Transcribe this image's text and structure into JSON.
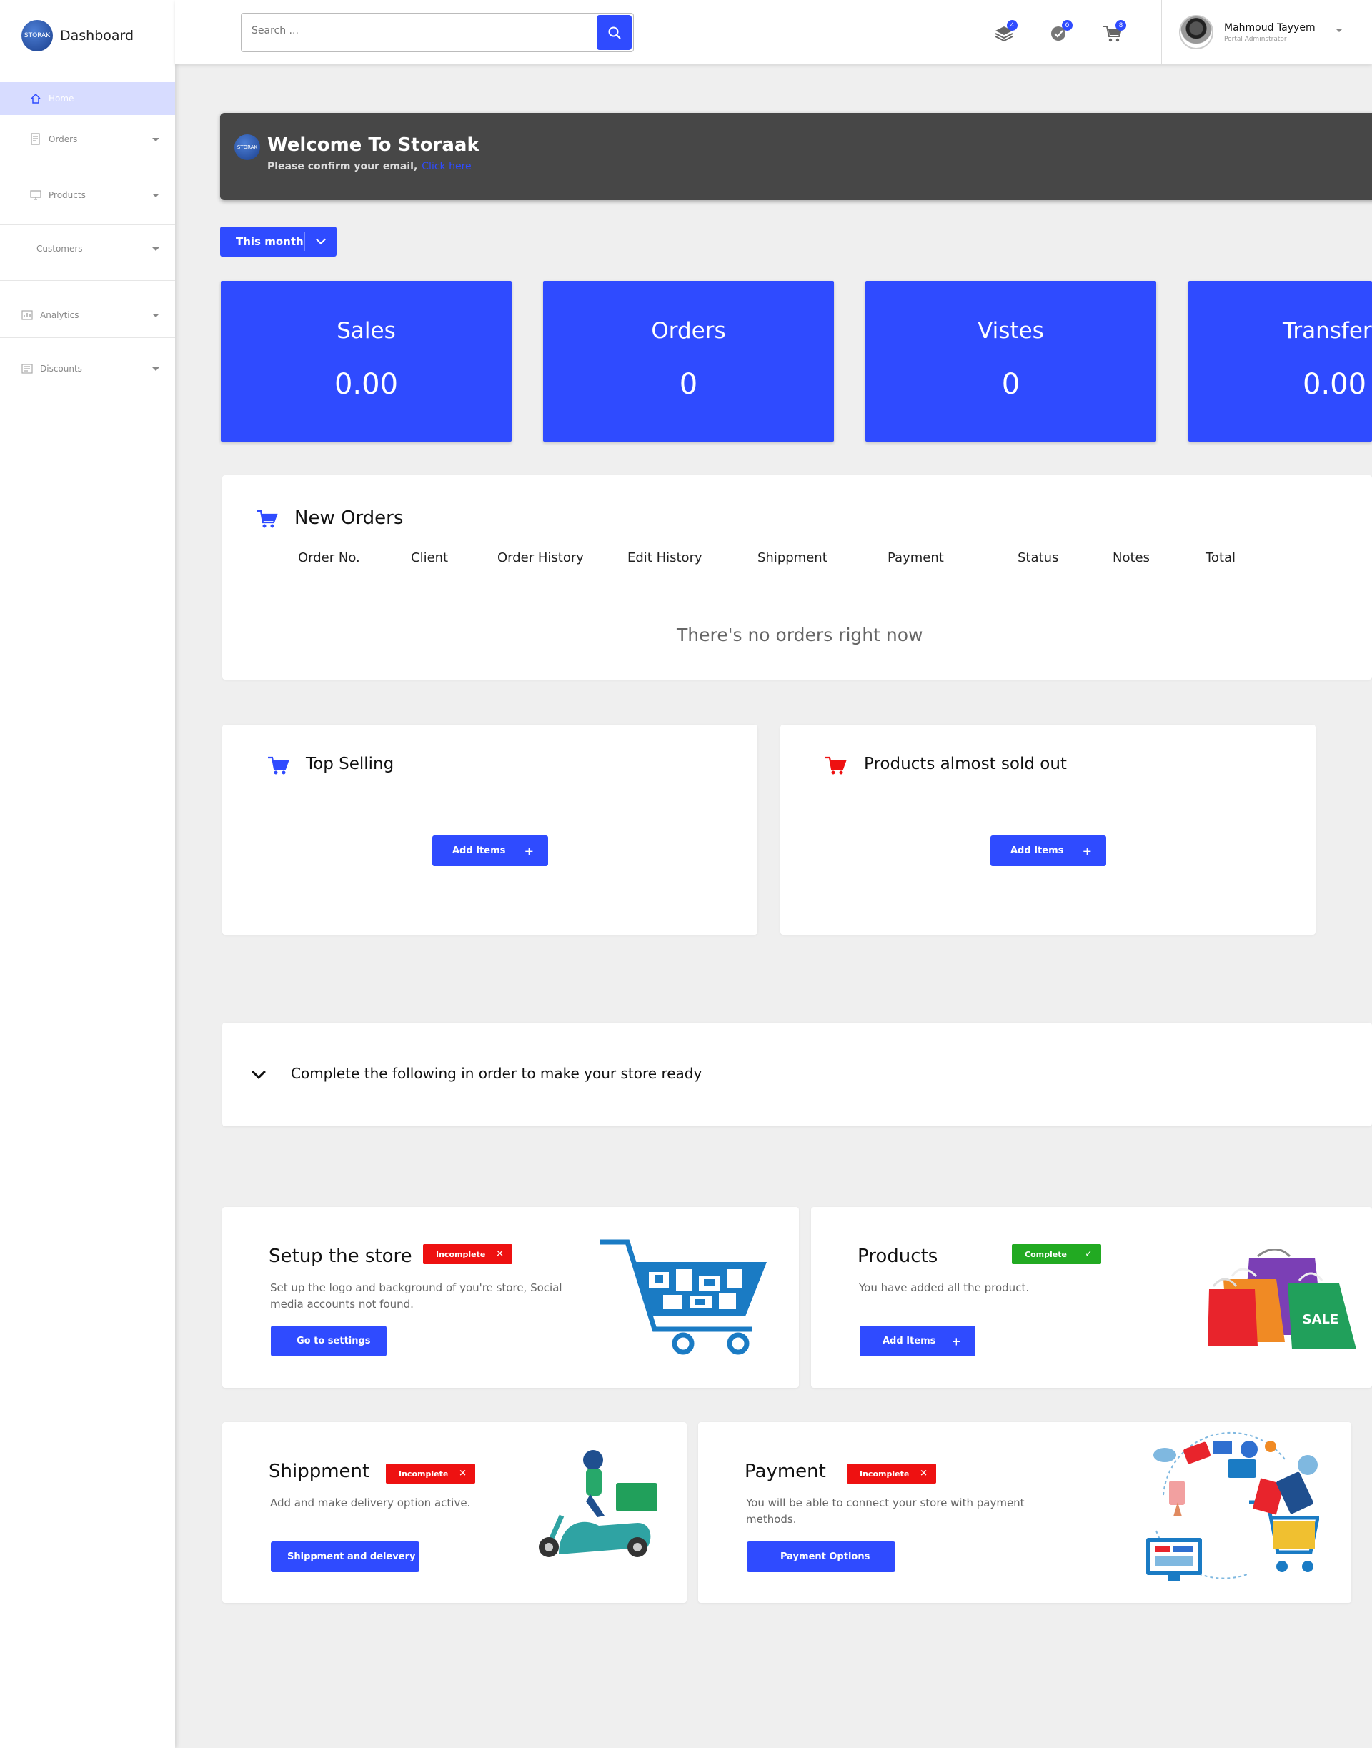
{
  "brand": {
    "logo_text": "STORAK",
    "title": "Dashboard"
  },
  "sidebar": {
    "items": [
      {
        "label": "Home",
        "icon": "home-icon"
      },
      {
        "label": "Orders",
        "icon": "orders-icon"
      },
      {
        "label": "Products",
        "icon": "monitor-icon"
      },
      {
        "label": "Customers",
        "icon": ""
      },
      {
        "label": "Analytics",
        "icon": "chart-icon"
      },
      {
        "label": "Discounts",
        "icon": "discount-icon"
      }
    ]
  },
  "topbar": {
    "search_placeholder": "Search ...",
    "notifications": [
      {
        "icon": "layers-icon",
        "count": "4"
      },
      {
        "icon": "check-circle-icon",
        "count": "0"
      },
      {
        "icon": "cart-icon",
        "count": "8"
      }
    ],
    "user": {
      "name": "Mahmoud Tayyem",
      "role": "Portal Adminstrator"
    }
  },
  "welcome": {
    "logo_text": "STORAK",
    "title": "Welcome To Storaak",
    "subtitle": "Please confirm your email,",
    "link": "Click here"
  },
  "period": {
    "label": "This month"
  },
  "stats": [
    {
      "label": "Sales",
      "value": "0.00"
    },
    {
      "label": "Orders",
      "value": "0"
    },
    {
      "label": "Vistes",
      "value": "0"
    },
    {
      "label": "Transfer",
      "value": "0.00"
    }
  ],
  "new_orders": {
    "title": "New Orders",
    "columns": [
      "Order No.",
      "Client",
      "Order History",
      "Edit History",
      "Shippment",
      "Payment",
      "Status",
      "Notes",
      "Total"
    ],
    "empty_message": "There's no orders right now"
  },
  "top_selling": {
    "title": "Top Selling",
    "button": "Add Items",
    "button_icon": "+"
  },
  "sold_out": {
    "title": "Products almost sold out",
    "button": "Add Items",
    "button_icon": "+"
  },
  "checklist": {
    "title": "Complete the following in order to make your store ready"
  },
  "setup_cards": {
    "setup": {
      "title": "Setup the store",
      "status": "Incomplete",
      "status_icon": "✕",
      "desc": "Set up the logo and background of you're store,  Social media accounts not found.",
      "button": "Go to settings"
    },
    "products": {
      "title": "Products",
      "status": "Complete",
      "status_icon": "✓",
      "desc": "You have added all the product.",
      "button": "Add Items",
      "button_icon": "+"
    },
    "shipment": {
      "title": "Shippment",
      "status": "Incomplete",
      "status_icon": "✕",
      "desc": "Add and make delivery option active.",
      "button": "Shippment and delevery"
    },
    "payment": {
      "title": "Payment",
      "status": "Incomplete",
      "status_icon": "✕",
      "desc": "You will be able to connect your store with payment methods.",
      "button": "Payment Options"
    }
  },
  "sale_tag": "SALE",
  "colors": {
    "accent": "#2f4bff",
    "incomplete": "#ee1111",
    "complete": "#22aa22",
    "banner": "#474747",
    "cart_red": "#ee1111"
  }
}
